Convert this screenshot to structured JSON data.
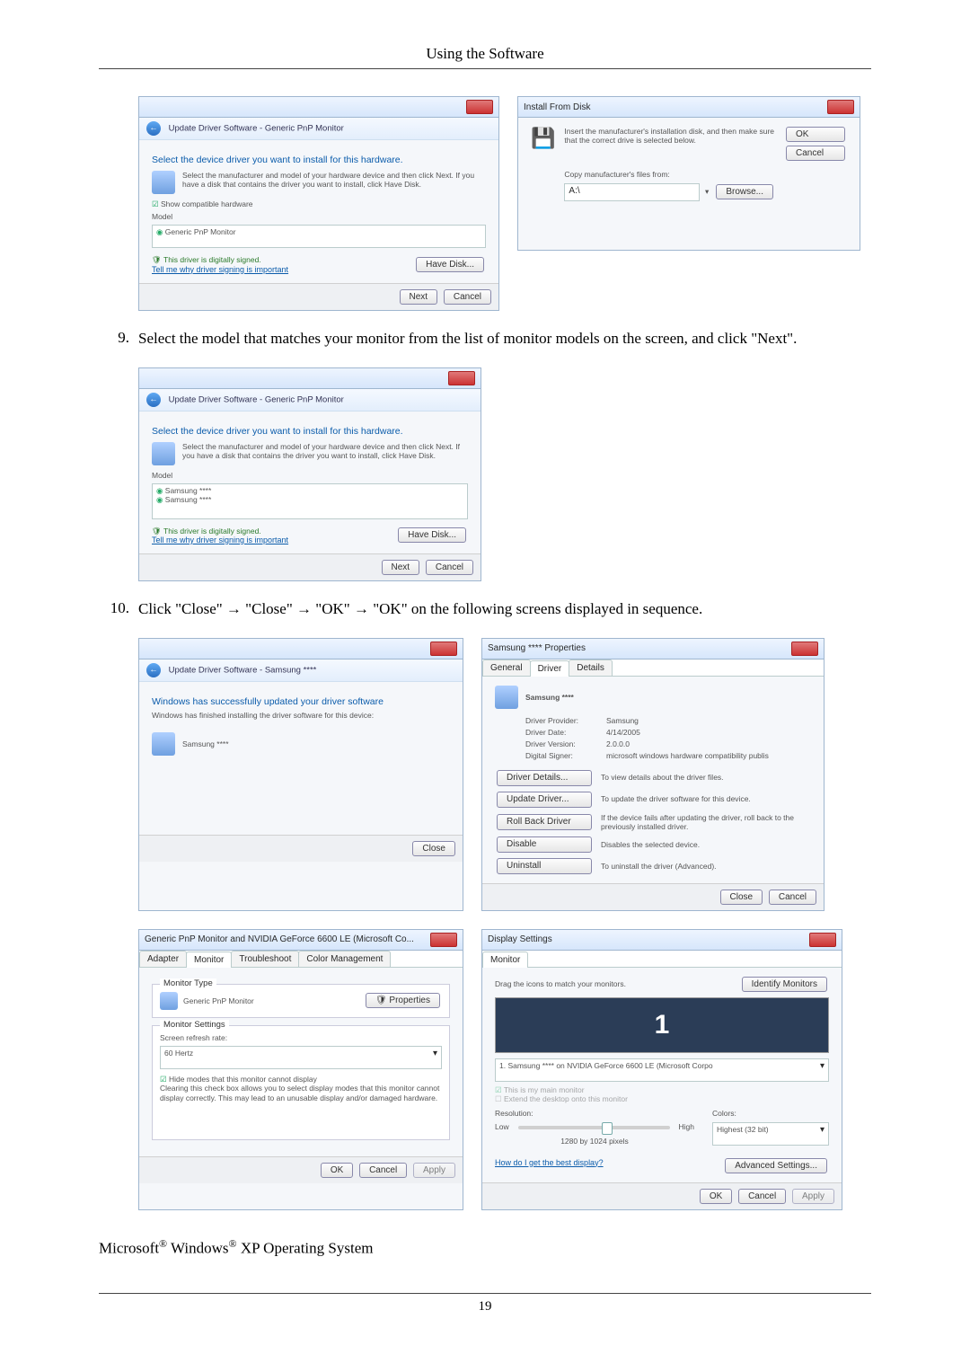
{
  "page_header": "Using the Software",
  "page_number": "19",
  "win_update1": {
    "crumb": "Update Driver Software - Generic PnP Monitor",
    "heading": "Select the device driver you want to install for this hardware.",
    "desc": "Select the manufacturer and model of your hardware device and then click Next. If you have a disk that contains the driver you want to install, click Have Disk.",
    "show_compat": "Show compatible hardware",
    "model_label": "Model",
    "model_item": "Generic PnP Monitor",
    "signed": "This driver is digitally signed.",
    "tell_me": "Tell me why driver signing is important",
    "have_disk": "Have Disk...",
    "next": "Next",
    "cancel": "Cancel"
  },
  "win_install_disk": {
    "title": "Install From Disk",
    "desc": "Insert the manufacturer's installation disk, and then make sure that the correct drive is selected below.",
    "ok": "OK",
    "cancel": "Cancel",
    "copy_label": "Copy manufacturer's files from:",
    "browse": "Browse..."
  },
  "step9_num": "9.",
  "step9_text": "Select the model that matches your monitor from the list of monitor models on the screen, and click \"Next\".",
  "win_update2": {
    "crumb": "Update Driver Software - Generic PnP Monitor",
    "heading": "Select the device driver you want to install for this hardware.",
    "desc": "Select the manufacturer and model of your hardware device and then click Next. If you have a disk that contains the driver you want to install, click Have Disk.",
    "model_label": "Model",
    "model_a": "Samsung ****",
    "model_b": "Samsung ****",
    "signed": "This driver is digitally signed.",
    "tell_me": "Tell me why driver signing is important",
    "have_disk": "Have Disk...",
    "next": "Next",
    "cancel": "Cancel"
  },
  "step10_num": "10.",
  "step10_text": "Click \"Close\" → \"Close\" → \"OK\" → \"OK\" on the following screens displayed in sequence.",
  "win_success": {
    "crumb": "Update Driver Software - Samsung ****",
    "heading": "Windows has successfully updated your driver software",
    "desc": "Windows has finished installing the driver software for this device:",
    "device": "Samsung ****",
    "close": "Close"
  },
  "win_props": {
    "title": "Samsung **** Properties",
    "tab_general": "General",
    "tab_driver": "Driver",
    "tab_details": "Details",
    "device": "Samsung ****",
    "provider_l": "Driver Provider:",
    "provider_v": "Samsung",
    "date_l": "Driver Date:",
    "date_v": "4/14/2005",
    "version_l": "Driver Version:",
    "version_v": "2.0.0.0",
    "signer_l": "Digital Signer:",
    "signer_v": "microsoft windows hardware compatibility publis",
    "btn_details": "Driver Details...",
    "btn_details_d": "To view details about the driver files.",
    "btn_update": "Update Driver...",
    "btn_update_d": "To update the driver software for this device.",
    "btn_roll": "Roll Back Driver",
    "btn_roll_d": "If the device fails after updating the driver, roll back to the previously installed driver.",
    "btn_disable": "Disable",
    "btn_disable_d": "Disables the selected device.",
    "btn_uninstall": "Uninstall",
    "btn_uninstall_d": "To uninstall the driver (Advanced).",
    "close": "Close",
    "cancel": "Cancel"
  },
  "win_generic": {
    "title": "Generic PnP Monitor and NVIDIA GeForce 6600 LE (Microsoft Co...",
    "tab_adapter": "Adapter",
    "tab_monitor": "Monitor",
    "tab_trouble": "Troubleshoot",
    "tab_color": "Color Management",
    "mtype_legend": "Monitor Type",
    "mtype_name": "Generic PnP Monitor",
    "properties": "Properties",
    "msettings_legend": "Monitor Settings",
    "refresh_l": "Screen refresh rate:",
    "refresh_v": "60 Hertz",
    "hide_check": "Hide modes that this monitor cannot display",
    "hide_desc": "Clearing this check box allows you to select display modes that this monitor cannot display correctly. This may lead to an unusable display and/or damaged hardware.",
    "ok": "OK",
    "cancel": "Cancel",
    "apply": "Apply"
  },
  "win_display": {
    "title": "Display Settings",
    "tab_monitor": "Monitor",
    "drag": "Drag the icons to match your monitors.",
    "identify": "Identify Monitors",
    "big": "1",
    "mon_sel": "1. Samsung **** on NVIDIA GeForce 6600 LE (Microsoft Corpo",
    "main_chk": "This is my main monitor",
    "extend_chk": "Extend the desktop onto this monitor",
    "res_l": "Resolution:",
    "low": "Low",
    "high": "High",
    "res_v": "1280 by 1024 pixels",
    "colors_l": "Colors:",
    "colors_v": "Highest (32 bit)",
    "best": "How do I get the best display?",
    "advanced": "Advanced Settings...",
    "ok": "OK",
    "cancel": "Cancel",
    "apply": "Apply"
  },
  "os_prefix": "Microsoft",
  "os_mid": " Windows",
  "os_suffix": " XP Operating System",
  "reg": "®"
}
